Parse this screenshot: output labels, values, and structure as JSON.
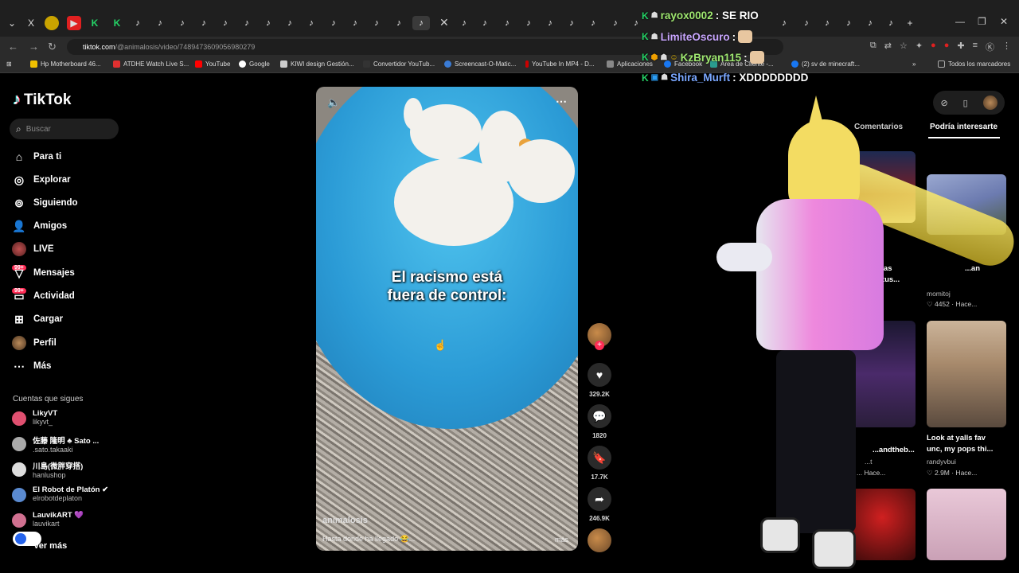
{
  "browser": {
    "url_host": "tiktok.com",
    "url_path": "/@animalosis/video/7489473609056980279",
    "bookmarks": [
      {
        "label": "Hp Motherboard 46...",
        "color": "#f0c000"
      },
      {
        "label": "ATDHE Watch Live S...",
        "color": "#e03030"
      },
      {
        "label": "YouTube",
        "color": "#ff0000"
      },
      {
        "label": "Google",
        "color": "#ffffff"
      },
      {
        "label": "KIWI design Gestión...",
        "color": "#cccccc"
      },
      {
        "label": "Convertidor YouTub...",
        "color": "#333333"
      },
      {
        "label": "Screencast-O-Matic...",
        "color": "#3a7bd5"
      },
      {
        "label": "YouTube In MP4 - D...",
        "color": "#cc0000"
      },
      {
        "label": "Aplicaciones",
        "color": "#888888"
      },
      {
        "label": "Facebook",
        "color": "#1877f2"
      },
      {
        "label": "Área de Cliente -...",
        "color": "#2a9d8f"
      },
      {
        "label": "(2) sv de minecraft...",
        "color": "#1877f2"
      },
      {
        "label": "Todos los marcadores",
        "color": "#888888"
      }
    ]
  },
  "sidebar": {
    "logo": "TikTok",
    "search_placeholder": "Buscar",
    "nav": [
      {
        "label": "Para ti",
        "icon": "home-icon"
      },
      {
        "label": "Explorar",
        "icon": "compass-icon"
      },
      {
        "label": "Siguiendo",
        "icon": "following-icon"
      },
      {
        "label": "Amigos",
        "icon": "friends-icon"
      },
      {
        "label": "LIVE",
        "icon": "live-icon"
      },
      {
        "label": "Mensajes",
        "icon": "message-icon"
      },
      {
        "label": "Actividad",
        "icon": "activity-icon"
      },
      {
        "label": "Cargar",
        "icon": "upload-icon"
      },
      {
        "label": "Perfil",
        "icon": "profile-icon"
      },
      {
        "label": "Más",
        "icon": "more-icon"
      }
    ],
    "badge": "99+",
    "following_title": "Cuentas que sigues",
    "following": [
      {
        "name": "LikyVT",
        "user": "likyvt_"
      },
      {
        "name": "佐藤 隆明 ♣ Sato ...",
        "user": ".sato.takaaki"
      },
      {
        "name": "川島(微胖穿搭)",
        "user": "hanlushop"
      },
      {
        "name": "El Robot de Platón ✔",
        "user": "elrobotdeplaton"
      },
      {
        "name": "LauvikART 💜",
        "user": "lauvikart"
      }
    ],
    "see_more": "Ver más"
  },
  "video": {
    "caption_line1": "El racismo está",
    "caption_line2": "fuera de control:",
    "author": "animalosis",
    "description": "Hasta donde ha llegado 😂...",
    "more": "más"
  },
  "actions": {
    "likes": "329.2K",
    "comments": "1820",
    "saves": "17.7K",
    "shares": "246.9K"
  },
  "chat": [
    {
      "user": "rayox0002",
      "msg": ": SE RIO",
      "color": "#9fe870"
    },
    {
      "user": "LimiteOscuro",
      "msg": ":",
      "color": "#c9a6ff"
    },
    {
      "user": "KzBryan115",
      "msg": ":",
      "color": "#9fe870"
    },
    {
      "user": "Shira_Murft",
      "msg": ": XDDDDDDDD",
      "color": "#7aa7ff"
    }
  ],
  "right_panel": {
    "tabs": [
      "Comentarios",
      "Podría interesarte"
    ],
    "cards": [
      {
        "title": "...an",
        "user": "momitoj",
        "meta": "♡ 4452 · Hace..."
      },
      {
        "title": "Look at yalls fav",
        "title2": "unc, my pops thi...",
        "user": "randyvbui",
        "meta": "♡ 2.9M · Hace..."
      },
      {
        "title": "...as",
        "title2": "...tus...",
        "user": "",
        "meta": ""
      },
      {
        "title": "...andtheb...",
        "user": "...t",
        "meta": "...  Hace..."
      }
    ]
  },
  "colors": {
    "accent": "#fe2c55",
    "cyan": "#25f4ee"
  }
}
